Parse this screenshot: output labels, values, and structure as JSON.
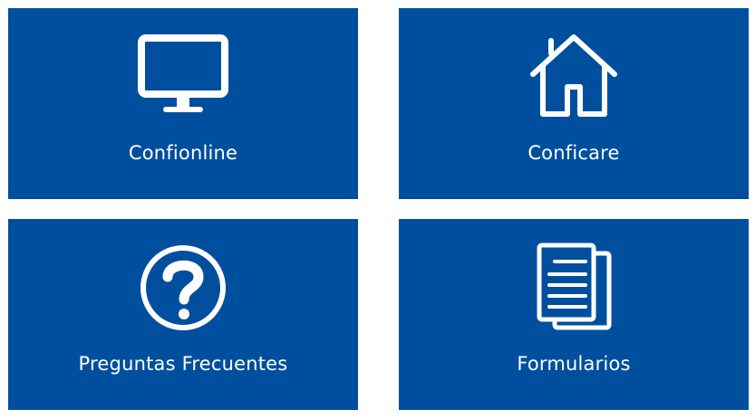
{
  "tiles": [
    {
      "label": "Confionline",
      "icon": "monitor-icon"
    },
    {
      "label": "Conficare",
      "icon": "home-icon"
    },
    {
      "label": "Preguntas Frecuentes",
      "icon": "question-circle-icon"
    },
    {
      "label": "Formularios",
      "icon": "documents-icon"
    }
  ],
  "colors": {
    "tile_background": "#004f9e",
    "tile_foreground": "#ffffff",
    "page_background": "#ffffff"
  }
}
